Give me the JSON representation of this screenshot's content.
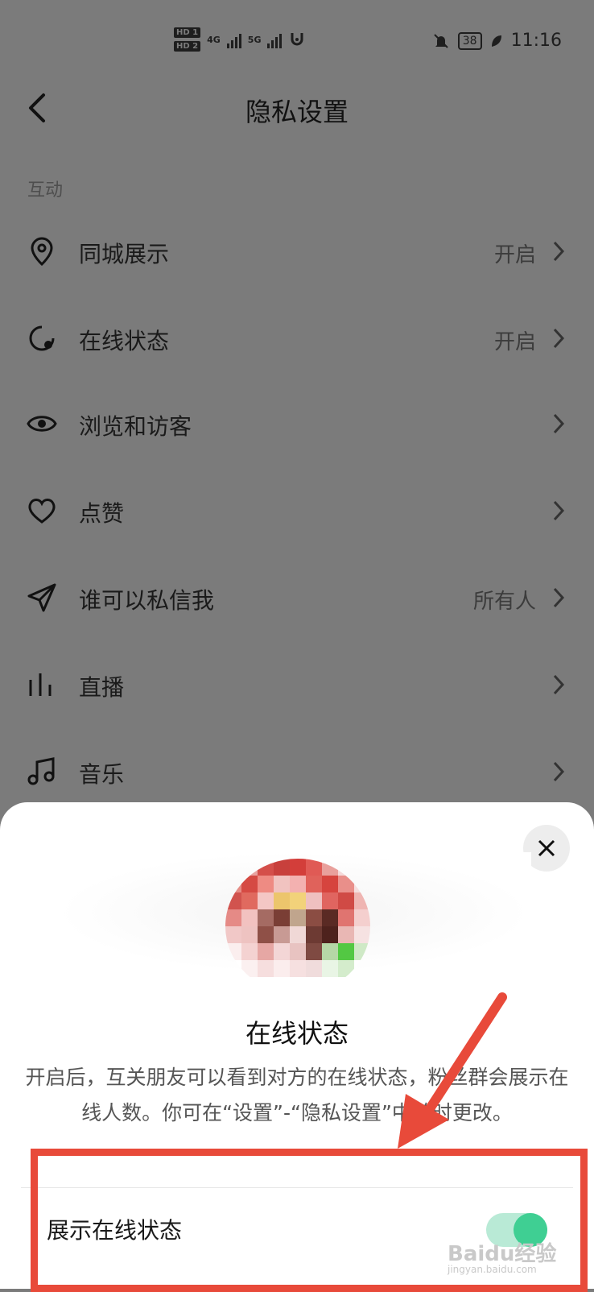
{
  "status_bar": {
    "sim1": "HD 1",
    "sim2": "HD 2",
    "net1": "4G",
    "net2": "5G",
    "battery": "38",
    "time": "11:16"
  },
  "header": {
    "title": "隐私设置"
  },
  "section": {
    "label": "互动"
  },
  "rows": [
    {
      "label": "同城展示",
      "value": "开启",
      "icon": "location-pin-icon"
    },
    {
      "label": "在线状态",
      "value": "开启",
      "icon": "online-status-icon"
    },
    {
      "label": "浏览和访客",
      "value": "",
      "icon": "eye-icon"
    },
    {
      "label": "点赞",
      "value": "",
      "icon": "heart-icon"
    },
    {
      "label": "谁可以私信我",
      "value": "所有人",
      "icon": "send-icon"
    },
    {
      "label": "直播",
      "value": "",
      "icon": "live-bars-icon"
    },
    {
      "label": "音乐",
      "value": "",
      "icon": "music-note-icon"
    }
  ],
  "sheet": {
    "title": "在线状态",
    "description": "开启后，互关朋友可以看到对方的在线状态，粉丝群会展示在线人数。你可在“设置”-“隐私设置”中随时更改。",
    "toggle_label": "展示在线状态",
    "toggle_on": true
  },
  "watermark": {
    "text": "Baidu经验",
    "sub": "jingyan.baidu.com"
  },
  "colors": {
    "overlay": "#7b7b7b",
    "toggle_on": "#3fcf93",
    "annotation": "#e84a3a"
  }
}
